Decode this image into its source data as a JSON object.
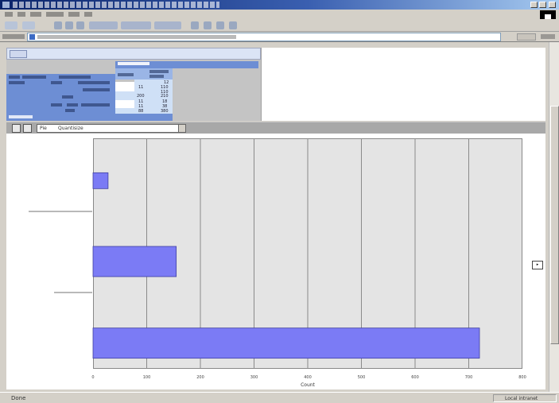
{
  "statusbar": {
    "text": "Done",
    "zone": "Local intranet"
  },
  "pivot": {
    "grid_values": [
      "12",
      "110",
      "11",
      "110",
      "200",
      "210",
      "11",
      "18",
      "11",
      "38",
      "88",
      "380"
    ]
  },
  "chart_toolbar": {
    "field_label": "Pie",
    "field_value": "Quantisize"
  },
  "chart_data": {
    "type": "bar",
    "orientation": "horizontal",
    "categories": [
      "",
      "",
      ""
    ],
    "values": [
      28,
      155,
      720
    ],
    "xlim": [
      0,
      800
    ],
    "x_ticks": [
      "0",
      "100",
      "200",
      "300",
      "400",
      "500",
      "600",
      "700",
      "800"
    ],
    "xlabel": "Count",
    "series_color": "#7b7bf5",
    "grid": true,
    "legend_button": "▸"
  }
}
